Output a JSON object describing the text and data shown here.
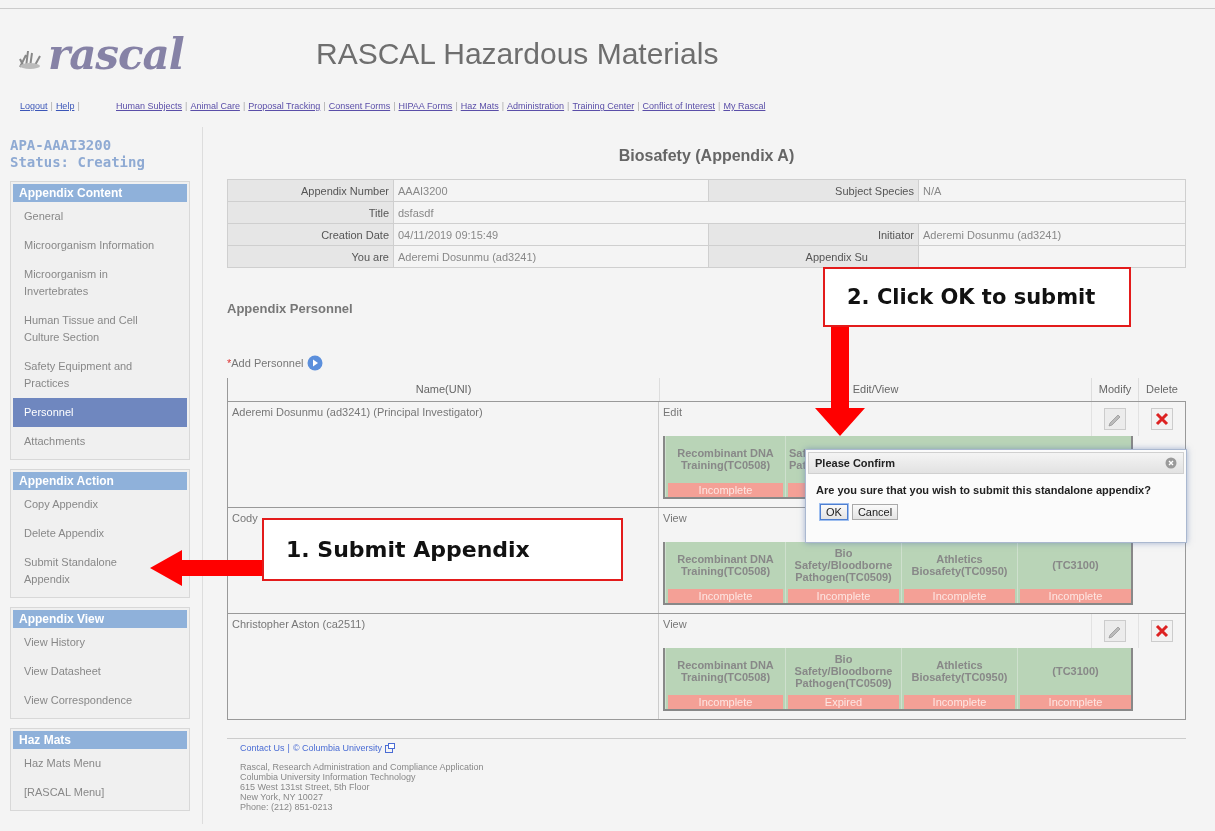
{
  "header": {
    "logo_text": "rascal",
    "title": "RASCAL Hazardous Materials"
  },
  "account_links": [
    {
      "label": "Logout",
      "separator": "|"
    },
    {
      "label": "Help",
      "separator": "|"
    }
  ],
  "nav_links": [
    {
      "label": "Human Subjects",
      "separator": "|"
    },
    {
      "label": "Animal Care",
      "separator": "|"
    },
    {
      "label": "Proposal Tracking",
      "separator": "|"
    },
    {
      "label": "Consent Forms",
      "separator": "|"
    },
    {
      "label": "HIPAA Forms",
      "separator": "|"
    },
    {
      "label": "Haz Mats",
      "separator": "|"
    },
    {
      "label": "Administration",
      "separator": "|"
    },
    {
      "label": "Training Center",
      "separator": "|"
    },
    {
      "label": "Conflict of Interest",
      "separator": "|"
    },
    {
      "label": "My Rascal"
    }
  ],
  "sidebar": {
    "record": "APA-AAAI3200",
    "status": "Status: Creating",
    "sections": [
      {
        "title": "Appendix Content",
        "items": [
          {
            "label": "General",
            "selected": false
          },
          {
            "label": "Microorganism Information",
            "selected": false
          },
          {
            "label": "Microorganism in Invertebrates",
            "selected": false
          },
          {
            "label": "Human Tissue and Cell Culture Section",
            "selected": false
          },
          {
            "label": "Safety Equipment and Practices",
            "selected": false
          },
          {
            "label": "Personnel",
            "selected": true
          },
          {
            "label": "Attachments",
            "selected": false
          }
        ]
      },
      {
        "title": "Appendix Action",
        "items": [
          {
            "label": "Copy Appendix",
            "selected": false
          },
          {
            "label": "Delete Appendix",
            "selected": false
          },
          {
            "label": "Submit Standalone Appendix",
            "selected": false
          }
        ]
      },
      {
        "title": "Appendix View",
        "items": [
          {
            "label": "View History",
            "selected": false
          },
          {
            "label": "View Datasheet",
            "selected": false
          },
          {
            "label": "View Correspondence",
            "selected": false
          }
        ]
      },
      {
        "title": "Haz Mats",
        "items": [
          {
            "label": "Haz Mats Menu",
            "selected": false
          },
          {
            "label": "[RASCAL Menu]",
            "selected": false
          }
        ]
      }
    ]
  },
  "main": {
    "heading": "Biosafety (Appendix A)",
    "info_rows": [
      {
        "label": "Appendix Number",
        "value": "AAAI3200",
        "label_2": "Subject Species",
        "value_2": "N/A"
      },
      {
        "label": "Title",
        "value": "dsfasdf"
      },
      {
        "label": "Creation Date",
        "value": "04/11/2019 09:15:49",
        "label_2": "Initiator",
        "value_2": "Aderemi Dosunmu (ad3241)"
      },
      {
        "label": "You are",
        "value": "Aderemi Dosunmu (ad3241)",
        "label_2": "Appendix Su",
        "label_2_covered": true
      }
    ],
    "personnel_heading": "Appendix Personnel",
    "add_personnel": {
      "required_mark": "*",
      "label": "Add Personnel"
    },
    "columns": [
      "Name(UNI)",
      "Edit/View",
      "Modify",
      "Delete"
    ],
    "rows": [
      {
        "name": "Aderemi Dosunmu (ad3241) (Principal Investigator)",
        "access": "Edit",
        "actions": true,
        "trainings": [
          {
            "title": "Recombinant DNA\nTraining(TC0508)",
            "status": "Incomplete"
          },
          {
            "title": "Saf\nPat",
            "cut": true
          }
        ]
      },
      {
        "name": "Cody",
        "access": "View",
        "trainings": [
          {
            "title": "Recombinant DNA\nTraining(TC0508)",
            "status": "Incomplete"
          },
          {
            "title": "Bio\nSafety/Bloodborne\nPathogen(TC0509)",
            "status": "Incomplete"
          },
          {
            "title": "Athletics\nBiosafety(TC0950)",
            "status": "Incomplete"
          },
          {
            "title": "(TC3100)",
            "status": "Incomplete"
          }
        ]
      },
      {
        "name": "Christopher Aston (ca2511)",
        "access": "View",
        "actions": true,
        "trainings": [
          {
            "title": "Recombinant DNA\nTraining(TC0508)",
            "status": "Incomplete"
          },
          {
            "title": "Bio\nSafety/Bloodborne\nPathogen(TC0509)",
            "status": "Expired"
          },
          {
            "title": "Athletics\nBiosafety(TC0950)",
            "status": "Incomplete"
          },
          {
            "title": "(TC3100)",
            "status": "Incomplete"
          }
        ]
      }
    ]
  },
  "footer": {
    "links": [
      "Contact Us",
      "© Columbia University"
    ],
    "separator": "|",
    "address": [
      "Rascal, Research Administration and Compliance Application",
      "Columbia University Information Technology",
      "615 West 131st Street, 5th Floor",
      "New York, NY 10027",
      "Phone: (212) 851-0213"
    ]
  },
  "dialog": {
    "title": "Please Confirm",
    "message": "Are you sure that you wish to submit this standalone appendix?",
    "buttons": [
      {
        "label": "OK",
        "selected": true
      },
      {
        "label": "Cancel",
        "selected": false
      }
    ]
  },
  "callouts": [
    {
      "text": "1. Submit Appendix",
      "kind": "left"
    },
    {
      "text": "2. Click OK to submit",
      "kind": "down"
    }
  ]
}
